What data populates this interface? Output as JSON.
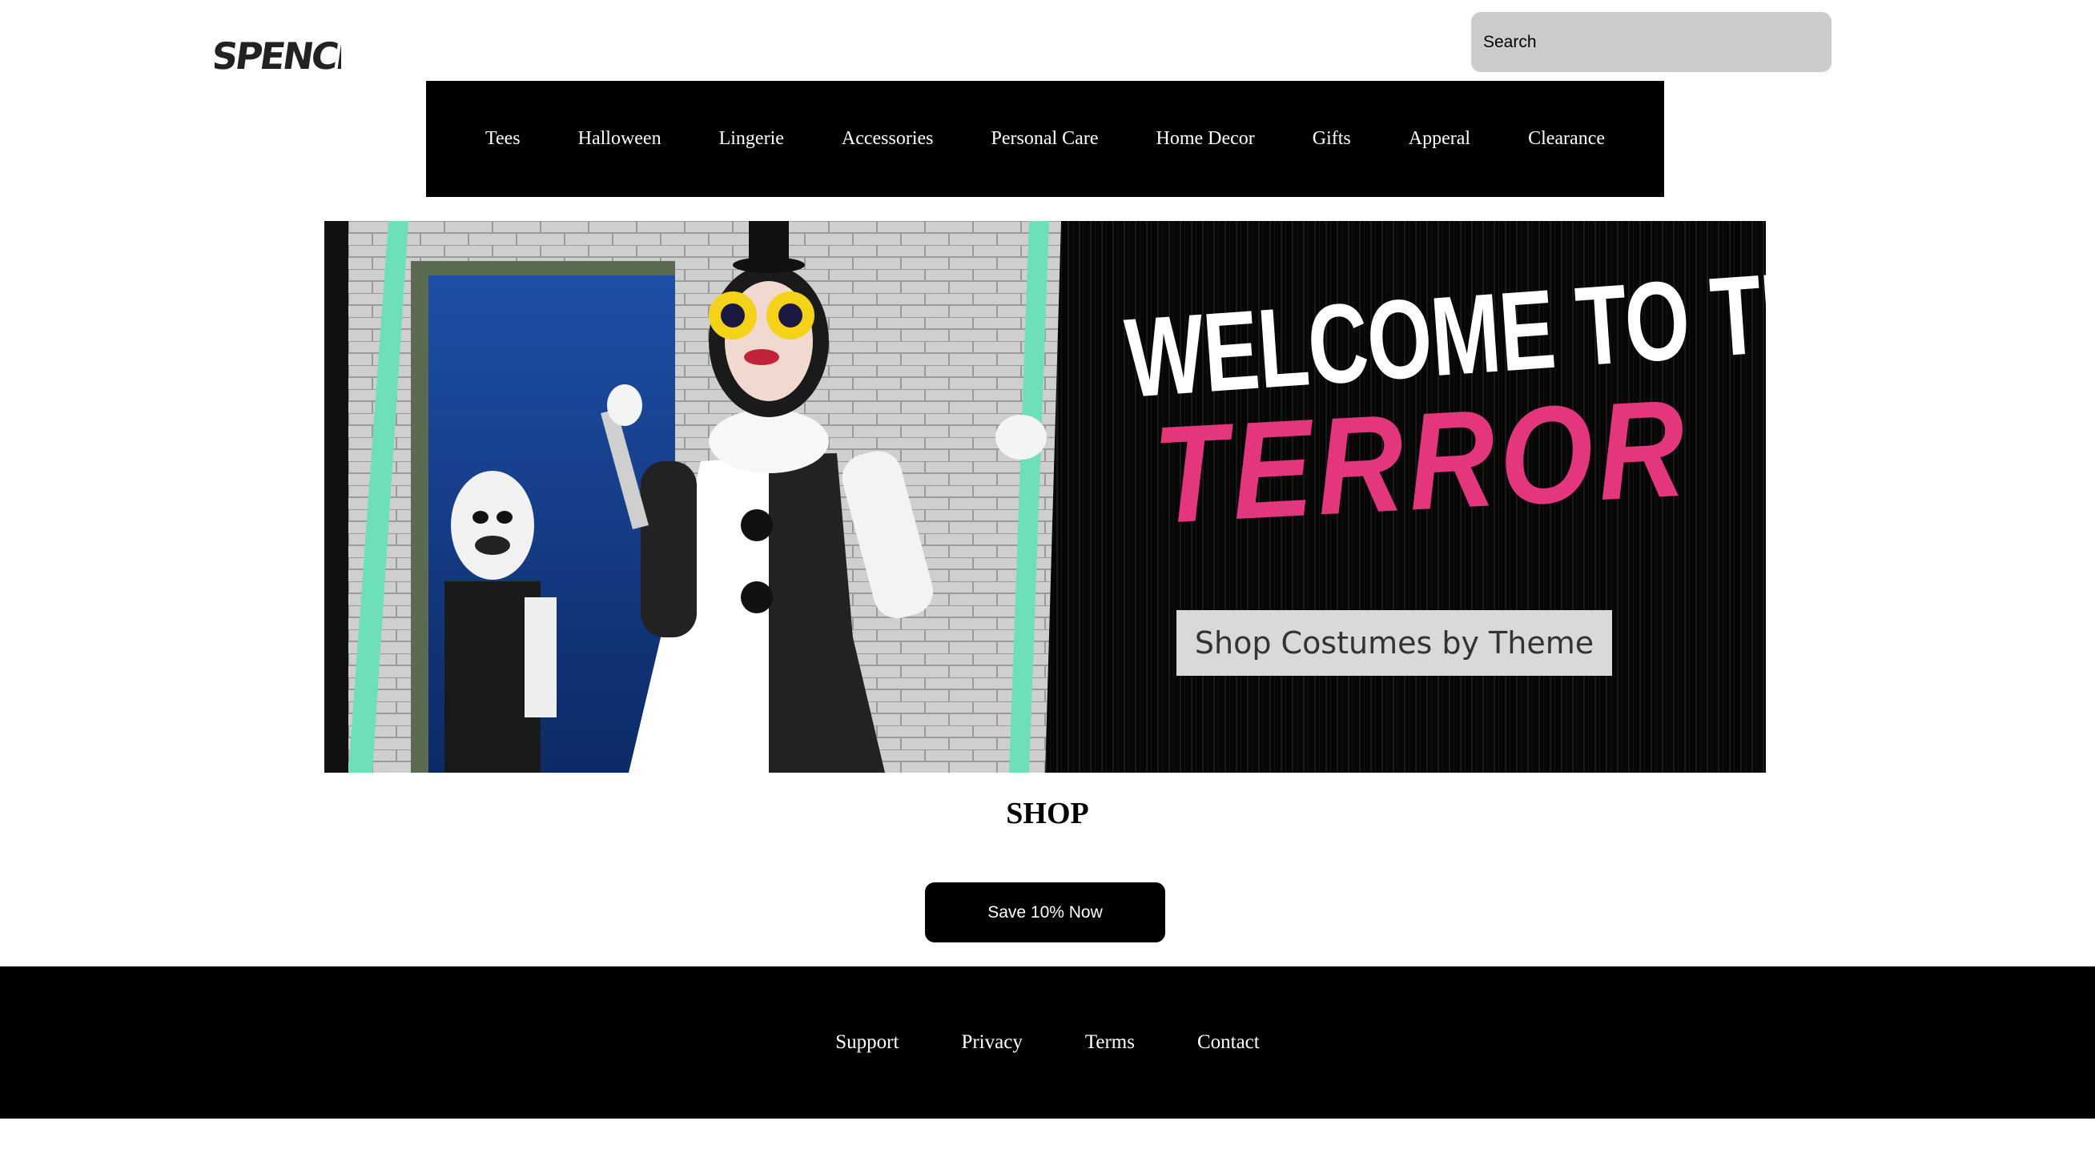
{
  "header": {
    "logo_text": "SPENCER'S",
    "search_placeholder": "Search"
  },
  "nav": {
    "items": [
      "Tees",
      "Halloween",
      "Lingerie",
      "Accessories",
      "Personal Care",
      "Home Decor",
      "Gifts",
      "Apperal",
      "Clearance"
    ]
  },
  "hero": {
    "headline_line1": "WELCOME TO THE",
    "headline_line2": "TERROR",
    "cta_label": "Shop Costumes by Theme",
    "accent_color": "#e4367c"
  },
  "main": {
    "section_title": "SHOP",
    "save_button_label": "Save 10% Now"
  },
  "footer": {
    "links": [
      "Support",
      "Privacy",
      "Terms",
      "Contact"
    ]
  }
}
